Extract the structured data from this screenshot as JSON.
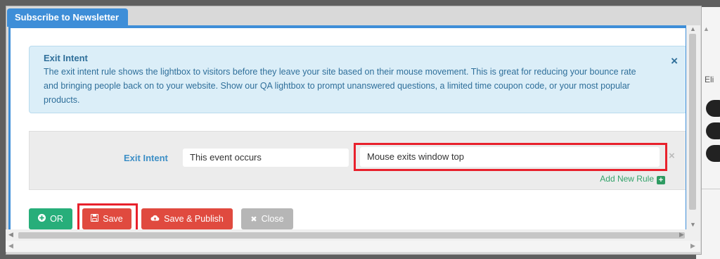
{
  "modal": {
    "tab_title": "Subscribe to Newsletter"
  },
  "info": {
    "title": "Exit Intent",
    "body": "The exit intent rule shows the lightbox to visitors before they leave your site based on their mouse movement. This is great for reducing your bounce rate and bringing people back on to your website. Show our QA lightbox to prompt unanswered questions, a limited time coupon code, or your most popular products.",
    "close_glyph": "×"
  },
  "rule": {
    "label": "Exit Intent",
    "event_value": "This event occurs",
    "condition_value": "Mouse exits window top",
    "remove_glyph": "×",
    "add_rule_label": "Add New Rule",
    "add_rule_glyph": "+"
  },
  "buttons": {
    "or_label": "OR",
    "save_label": "Save",
    "save_publish_label": "Save & Publish",
    "close_label": "Close"
  },
  "icons": {
    "or": "plus-circle-icon",
    "save": "floppy-disk-icon",
    "publish": "cloud-upload-icon",
    "close": "x-icon"
  },
  "background": {
    "right_text": "Eli"
  },
  "colors": {
    "tab_blue": "#3e8ed8",
    "info_bg": "#dbeef8",
    "info_text": "#2f6f9a",
    "green": "#27ae7a",
    "red": "#e04a3f",
    "gray": "#b6b6b6",
    "highlight": "#e8212c"
  }
}
